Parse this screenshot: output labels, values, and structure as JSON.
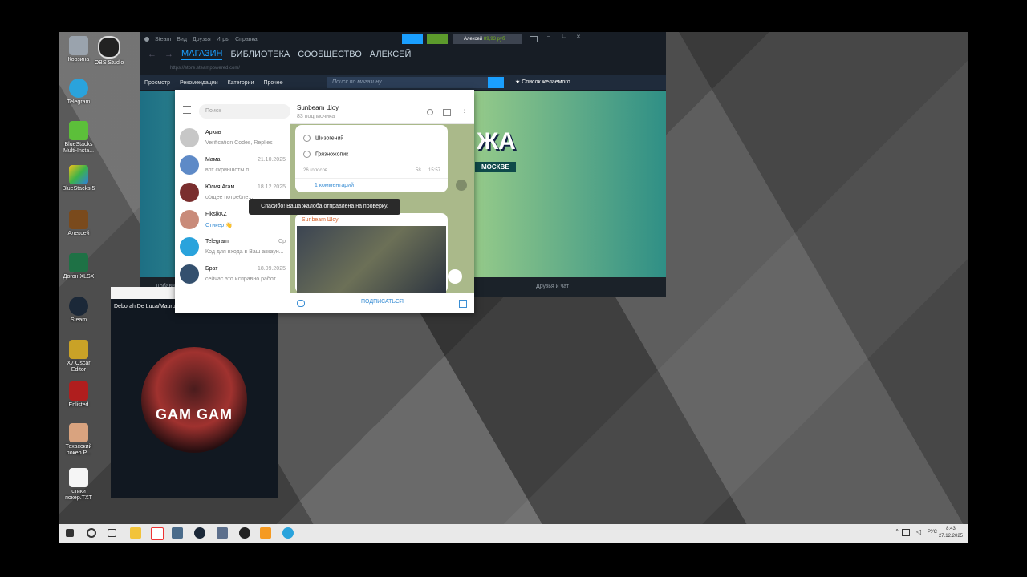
{
  "desktop": {
    "icons": [
      "Корзина",
      "OBS Studio",
      "Telegram",
      "BlueStacks Multi-Insta...",
      "BlueStacks 5",
      "Алексей",
      "Догон.XLSX",
      "Steam",
      "X7 Oscar Editor",
      "Enlisted",
      "Техасский покер P...",
      "стики покер.TXT"
    ]
  },
  "steam": {
    "menu": [
      "Steam",
      "Вид",
      "Друзья",
      "Игры",
      "Справка"
    ],
    "account": "Алексей",
    "balance": "89,93 руб",
    "nav": [
      "МАГАЗИН",
      "БИБЛИОТЕКА",
      "СООБЩЕСТВО",
      "АЛЕКСЕЙ"
    ],
    "url": "https://store.steampowered.com/",
    "store_menu": [
      "Просмотр",
      "Рекомендации",
      "Категории",
      "Прочее"
    ],
    "search_placeholder": "Поиск по магазину",
    "wishlist": "Список желаемого",
    "banner_text": "ЖА",
    "banner_sub": "МОСКВЕ",
    "bottom_left": "Добави",
    "bottom_right": "Друзья и чат"
  },
  "telegram": {
    "search_placeholder": "Поиск",
    "chats": [
      {
        "name": "Архив",
        "preview": "Verification Codes, Replies",
        "date": ""
      },
      {
        "name": "Мама",
        "preview": "вот скриншоты п...",
        "date": "21.10.2025"
      },
      {
        "name": "Юлия Агам...",
        "preview": "общее потребле...",
        "date": "18.12.2025"
      },
      {
        "name": "FiksikKZ",
        "preview": "Стикер 👋",
        "date": ""
      },
      {
        "name": "Telegram",
        "preview": "Код для входа в Ваш аккаун...",
        "date": "Ср"
      },
      {
        "name": "Брат",
        "preview": "сейчас это исправно работ...",
        "date": "18.09.2025"
      }
    ],
    "channel_title": "Sunbeam Шоу",
    "channel_subs": "83 подписчика",
    "poll_options": [
      "Шизогений",
      "Грязножопик"
    ],
    "votes": "26 голосов",
    "views": "58",
    "time": "15:57",
    "comments": "1 комментарий",
    "post_author": "Sunbeam Шоу",
    "toast": "Спасибо! Ваша жалоба отправлена на проверку.",
    "subscribe": "ПОДПИСАТЬСЯ"
  },
  "music": {
    "title": "Deborah De Luca/Mauro F",
    "cover_title": "GAM GAM"
  },
  "taskbar": {
    "lang": "РУС",
    "time": "8:43",
    "date": "27.12.2025"
  }
}
